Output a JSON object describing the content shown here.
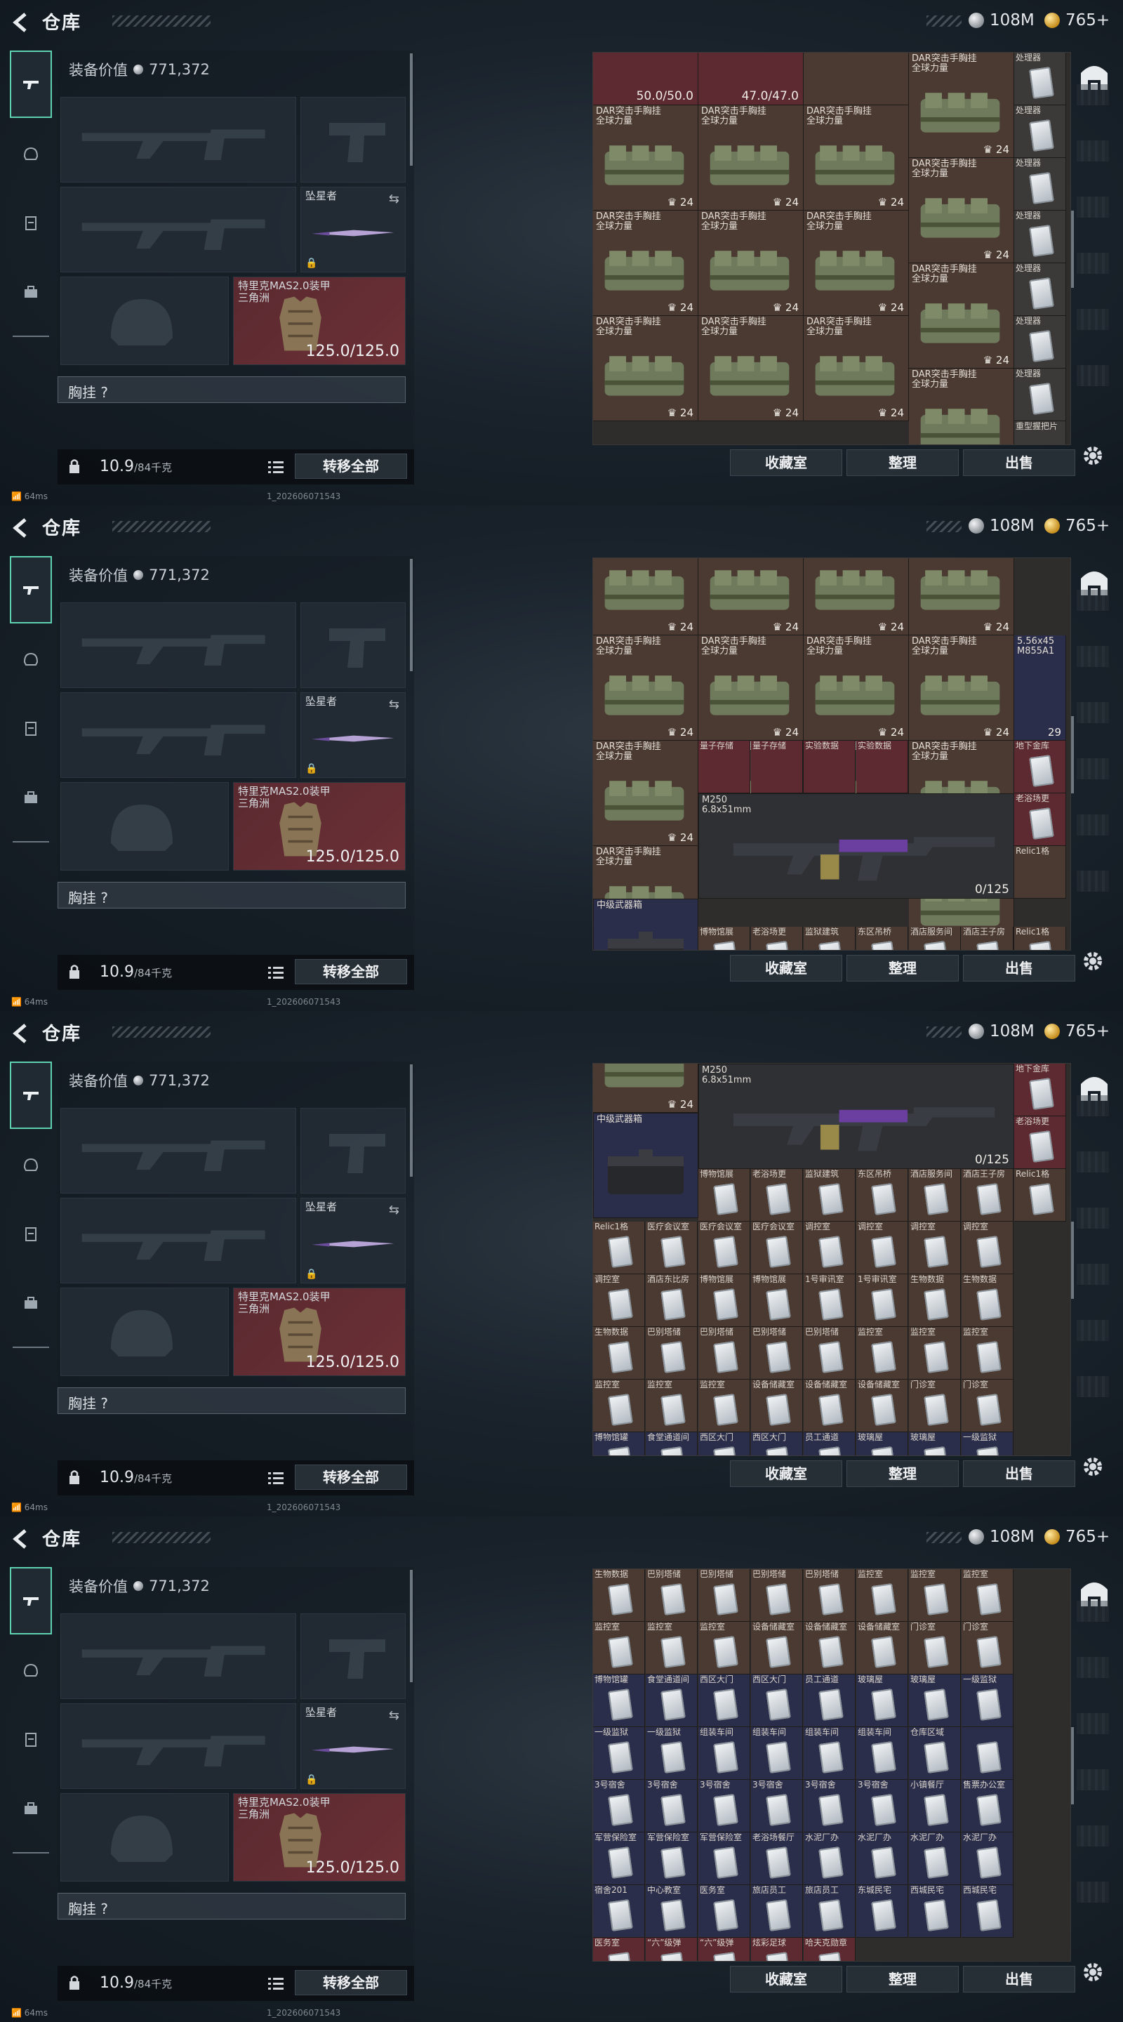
{
  "header": {
    "title": "仓库",
    "silver": "108M",
    "gold": "765+"
  },
  "left": {
    "equip_value_label": "装备价值",
    "equip_value": "771,372",
    "melee_name": "坠星者",
    "armor_name": "特里克MAS2.0装甲",
    "armor_sub": "三角洲",
    "armor_durability": "125.0/125.0",
    "vest_label": "胸挂 ?",
    "weight": "10.9",
    "weight_max": "/84千克",
    "transfer_all": "转移全部"
  },
  "status": {
    "ping": "64ms",
    "build": "1_202606071543"
  },
  "buttons": {
    "collection": "收藏室",
    "sort": "整理",
    "sell": "出售"
  },
  "icons": {
    "back": "back-arrow-icon",
    "settings": "gear-icon",
    "lock": "lock-icon"
  },
  "panel1": {
    "helmet_a": "50.0/50.0",
    "helmet_b": "47.0/47.0",
    "bag_name": "DAR突击手胸挂",
    "bag_sub": "全球力量",
    "bag_count": "24",
    "processor": "处理器",
    "grip": "重型握把片"
  },
  "panel2": {
    "storage": "量子存储",
    "data": "实验数据",
    "gun_name": "M250",
    "gun_caliber": "6.8x51mm",
    "gun_ammo": "0/125",
    "crate": "中级武器箱",
    "ammo_name": "5.56x45",
    "ammo_sub": "M855A1",
    "ammo_count": "29",
    "key1": "地下金库",
    "key2": "老浴场更",
    "relic": "Relic1格"
  },
  "keys_row_a": [
    "博物馆展",
    "老浴场更",
    "监狱建筑",
    "东区吊桥",
    "酒店服务间",
    "酒店王子房",
    "Relic1格"
  ],
  "keys_row_b": [
    "Relic1格",
    "医疗会议室",
    "医疗会议室",
    "医疗会议室",
    "调控室",
    "调控室",
    "调控室",
    "调控室"
  ],
  "keys_row_c": [
    "调控室",
    "酒店东比房",
    "博物馆展",
    "博物馆展",
    "1号审讯室",
    "1号审讯室",
    "生物数据",
    "生物数据"
  ],
  "keys_row_d": [
    "生物数据",
    "巴别塔储",
    "巴别塔储",
    "巴别塔储",
    "巴别塔储",
    "监控室",
    "监控室",
    "监控室"
  ],
  "keys_row_e": [
    "监控室",
    "监控室",
    "监控室",
    "设备储藏室",
    "设备储藏室",
    "设备储藏室",
    "门诊室",
    "门诊室"
  ],
  "keys_row_f": [
    "博物馆罐",
    "食堂通道间",
    "西区大门",
    "西区大门",
    "员工通道",
    "玻璃屋",
    "玻璃屋",
    "一级监狱"
  ],
  "keys_row_g": [
    "一级监狱",
    "一级监狱",
    "组装车间",
    "组装车间",
    "组装车间",
    "组装车间",
    "仓库区域"
  ],
  "keys_row_h": [
    "3号宿舍",
    "3号宿舍",
    "3号宿舍",
    "3号宿舍",
    "3号宿舍",
    "3号宿舍",
    "小镇餐厅",
    "售票办公室"
  ],
  "keys_row_i": [
    "军营保险室",
    "军营保险室",
    "军营保险室",
    "老浴场餐厅",
    "水泥厂办",
    "水泥厂办",
    "水泥厂办",
    "水泥厂办"
  ],
  "keys_row_j": [
    "宿舍201",
    "中心教室",
    "医务室",
    "旅店员工",
    "旅店员工",
    "东城民宅",
    "西城民宅",
    "西城民宅"
  ],
  "keys_row_k": [
    "医务室",
    "“六”级弹",
    "“六”级弹",
    "炫彩足球",
    "哈夫克勋章"
  ]
}
